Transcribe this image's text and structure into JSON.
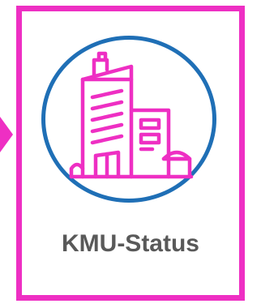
{
  "card": {
    "title": "KMU-Status",
    "icon": "office-building-icon"
  },
  "colors": {
    "accent": "#ee2fc3",
    "ring": "#1f6fb6",
    "text": "#595959"
  }
}
